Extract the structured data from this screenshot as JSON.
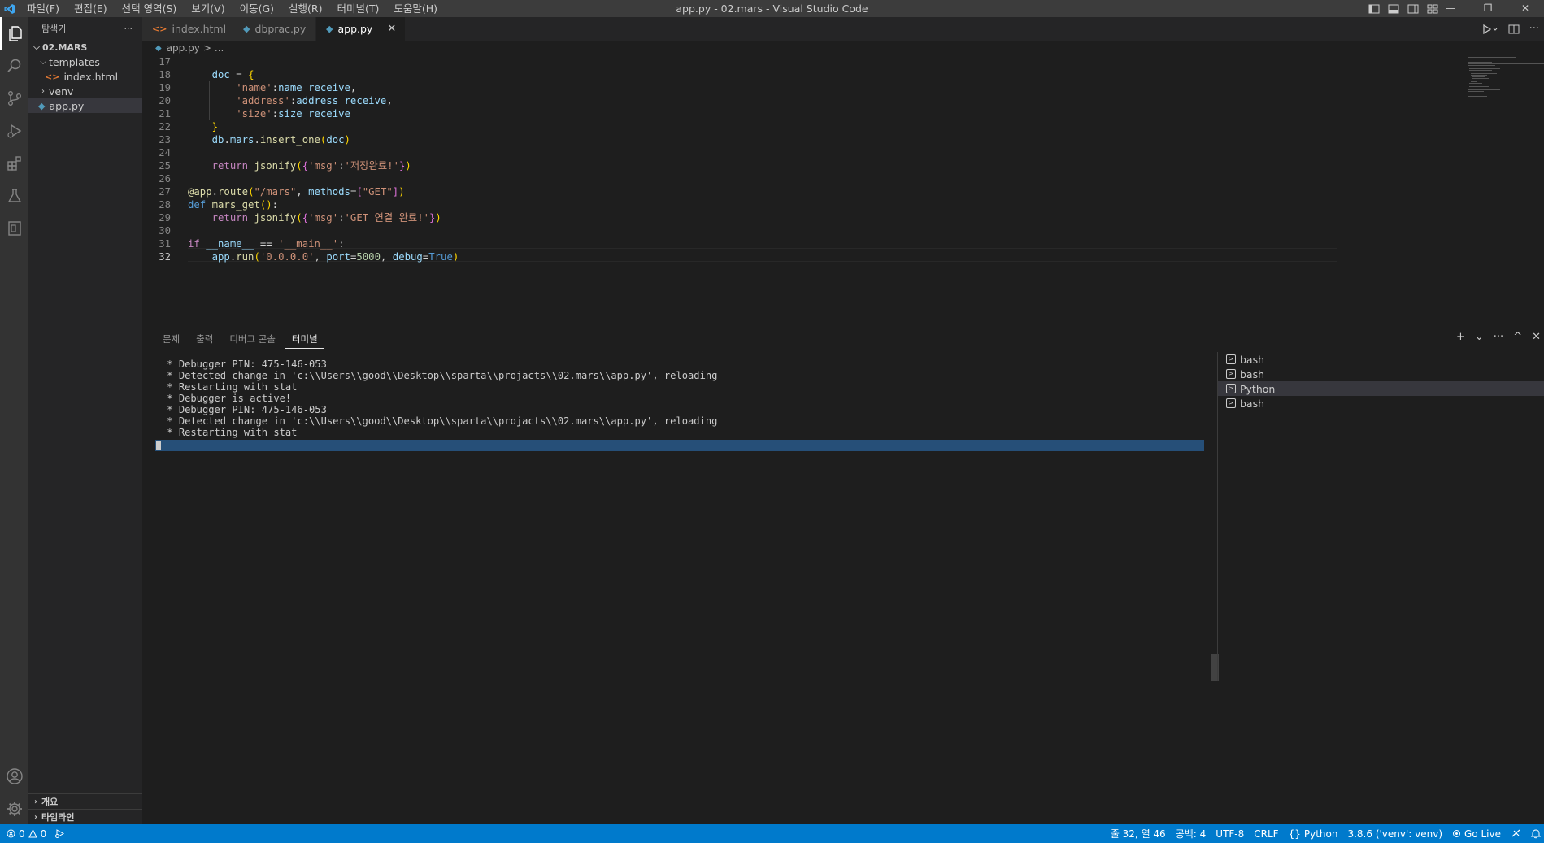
{
  "window": {
    "title": "app.py - 02.mars - Visual Studio Code"
  },
  "menu": [
    "파일(F)",
    "편집(E)",
    "선택 영역(S)",
    "보기(V)",
    "이동(G)",
    "실행(R)",
    "터미널(T)",
    "도움말(H)"
  ],
  "window_controls": {
    "minimize": "—",
    "restore": "❐",
    "close": "✕"
  },
  "sidebar": {
    "title": "탐색기",
    "more": "···",
    "root": "02.MARS",
    "tree": [
      {
        "label": "templates",
        "type": "folder-open",
        "indent": 1
      },
      {
        "label": "index.html",
        "type": "html",
        "indent": 2
      },
      {
        "label": "venv",
        "type": "folder-closed",
        "indent": 1
      },
      {
        "label": "app.py",
        "type": "python",
        "indent": 1,
        "selected": true
      }
    ],
    "bottom": [
      "개요",
      "타임라인"
    ]
  },
  "tabs": [
    {
      "label": "index.html",
      "icon": "html",
      "active": false
    },
    {
      "label": "dbprac.py",
      "icon": "python",
      "active": false
    },
    {
      "label": "app.py",
      "icon": "python",
      "active": true
    }
  ],
  "breadcrumb": {
    "file": "app.py",
    "sep": ">",
    "rest": "..."
  },
  "editor": {
    "lines": [
      17,
      18,
      19,
      20,
      21,
      22,
      23,
      24,
      25,
      26,
      27,
      28,
      29,
      30,
      31,
      32
    ],
    "current_line": 32
  },
  "panel": {
    "tabs": [
      "문제",
      "출력",
      "디버그 콘솔",
      "터미널"
    ],
    "active_tab": "터미널",
    "actions": {
      "add": "+",
      "dropdown": "⌄",
      "more": "···",
      "maximize": "^",
      "close": "✕"
    },
    "terminal_lines": [
      " * Debugger PIN: 475-146-053",
      " * Detected change in 'c:\\\\Users\\\\good\\\\Desktop\\\\sparta\\\\projacts\\\\02.mars\\\\app.py', reloading",
      " * Restarting with stat",
      " * Debugger is active!",
      " * Debugger PIN: 475-146-053",
      " * Detected change in 'c:\\\\Users\\\\good\\\\Desktop\\\\sparta\\\\projacts\\\\02.mars\\\\app.py', reloading",
      " * Restarting with stat"
    ],
    "terminals": [
      {
        "label": "bash",
        "active": false
      },
      {
        "label": "bash",
        "active": false
      },
      {
        "label": "Python",
        "active": true
      },
      {
        "label": "bash",
        "active": false
      }
    ]
  },
  "statusbar": {
    "errors": "0",
    "warnings": "0",
    "position": "줄 32, 열 46",
    "spaces": "공백: 4",
    "encoding": "UTF-8",
    "eol": "CRLF",
    "language": "Python",
    "interpreter": "3.8.6 ('venv': venv)",
    "golive": "Go Live"
  }
}
